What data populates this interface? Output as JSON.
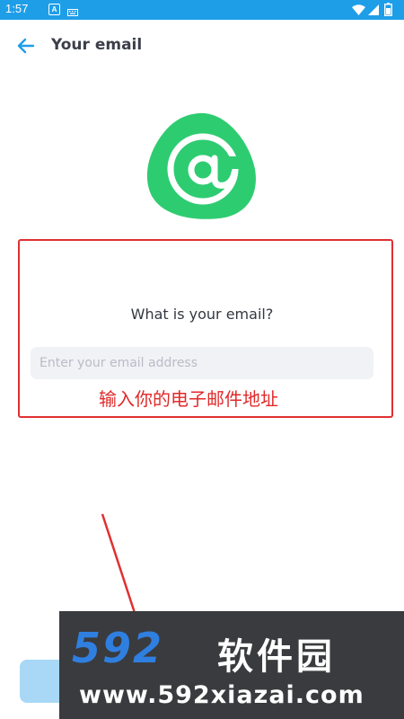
{
  "status_bar": {
    "time": "1:57",
    "icons": [
      "a-notification-icon",
      "keyboard-icon",
      "wifi-icon",
      "cell-signal-icon",
      "battery-icon"
    ],
    "background": "#1f9ee8"
  },
  "header": {
    "title": "Your email",
    "back_icon": "arrow-left-icon",
    "accent": "#1f9ee8"
  },
  "logo": {
    "icon": "at-sign-icon",
    "color": "#2ecc71"
  },
  "form": {
    "question": "What is your email?",
    "email_placeholder": "Enter your email address",
    "email_value": ""
  },
  "annotation": {
    "text": "输入你的电子邮件地址",
    "color": "#e02a2a"
  },
  "continue_button": {
    "color": "#a8d8f6"
  },
  "watermark": {
    "brand": "592",
    "brand_cn": "软件园",
    "url": "www.592xiazai.com"
  }
}
